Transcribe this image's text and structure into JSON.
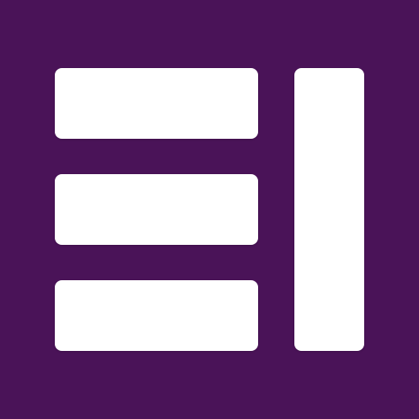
{
  "logo": {
    "icon": "layout-grid-icon",
    "background_color": "#4a1358",
    "foreground_color": "#ffffff",
    "shapes": [
      {
        "role": "horizontal-bar"
      },
      {
        "role": "horizontal-bar"
      },
      {
        "role": "horizontal-bar"
      },
      {
        "role": "vertical-bar"
      }
    ]
  }
}
